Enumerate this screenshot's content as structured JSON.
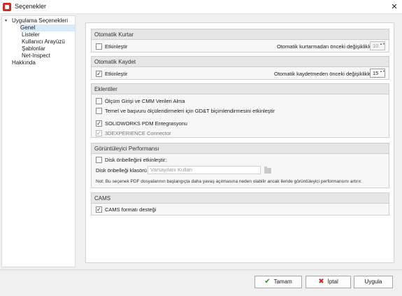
{
  "window": {
    "title": "Seçenekler",
    "close_glyph": "✕",
    "icon": "app-icon"
  },
  "tree": {
    "expand_glyph": "▾",
    "root_label": "Uygulama Seçenekleri",
    "children": [
      "Genel",
      "Listeler",
      "Kullanıcı Arayüzü",
      "Şablonlar",
      "Net-Inspect"
    ],
    "selected": "Genel",
    "about_label": "Hakkında"
  },
  "groups": {
    "autorecover": {
      "header": "Otomatik Kurtar",
      "enable_label": "Etkinleştir",
      "enable_checked": false,
      "interval_label": "Otomatik kurtarmadan önceki değişiklikler:",
      "interval_value": "10"
    },
    "autosave": {
      "header": "Otomatik Kaydet",
      "enable_label": "Etkinleştir",
      "enable_checked": true,
      "interval_label": "Otomatik kaydetmeden önceki değişiklikler:",
      "interval_value": "15"
    },
    "addins": {
      "header": "Eklentiler",
      "items": [
        {
          "label": "Ölçüm Girişi ve CMM Verileri Alma",
          "checked": false,
          "enabled": true
        },
        {
          "label": "Temel ve başvuru ölçülendirmeleri için GD&T biçimlendirmesini etkinleştir",
          "checked": false,
          "enabled": true
        },
        {
          "label": "SOLIDWORKS PDM Entegrasyonu",
          "checked": true,
          "enabled": true
        },
        {
          "label": "3DEXPERIENCE Connector",
          "checked": true,
          "enabled": false
        }
      ]
    },
    "viewer_perf": {
      "header": "Görüntüleyici Performansı",
      "disk_cache_label": "Disk önbelleğini etkinleştir:",
      "disk_cache_checked": false,
      "folder_label": "Disk önbelleği klasörü",
      "folder_placeholder": "Varsayılanı Kullan",
      "note": "Not: Bu seçenek PDF dosyalarının başlangıçta daha yavaş açılmasına neden olabilir ancak ileride görüntüleyici performansını artırır."
    },
    "cams": {
      "header": "CAMS",
      "support_label": "CAMS formatı desteği",
      "support_checked": true
    }
  },
  "buttons": {
    "ok": "Tamam",
    "cancel": "İptal",
    "apply": "Uygula",
    "ok_glyph": "✔",
    "cancel_glyph": "✖"
  },
  "check_glyph": "✓",
  "spin_glyph": "▲▼"
}
